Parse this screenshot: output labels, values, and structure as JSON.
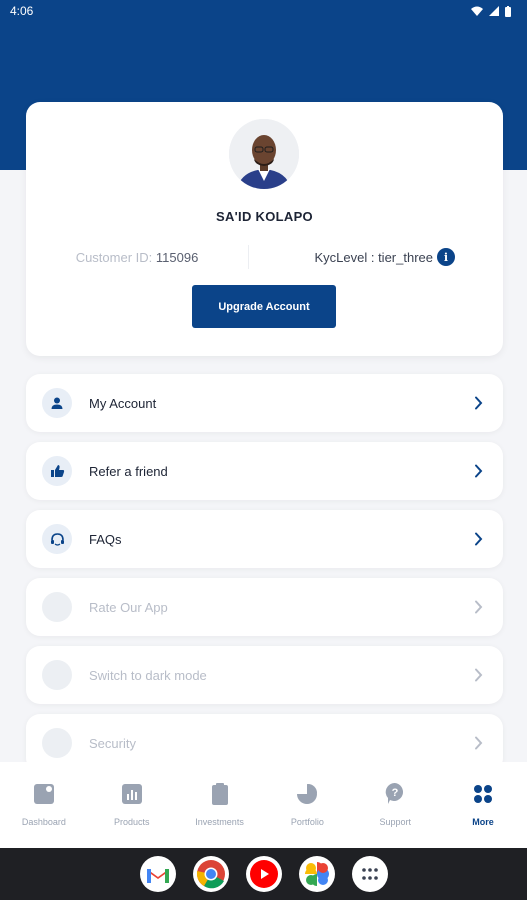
{
  "status_bar": {
    "time": "4:06"
  },
  "profile": {
    "name": "SA'ID KOLAPO",
    "customer_id_label": "Customer ID:",
    "customer_id_value": "115096",
    "kyc_label": "KycLevel : tier_three",
    "info_icon": "i",
    "upgrade_label": "Upgrade Account"
  },
  "menu": [
    {
      "label": "My Account",
      "icon": "person-icon",
      "enabled": true
    },
    {
      "label": "Refer a friend",
      "icon": "thumbs-up-icon",
      "enabled": true
    },
    {
      "label": "FAQs",
      "icon": "faq-icon",
      "enabled": true
    },
    {
      "label": "Rate Our App",
      "icon": "star-icon",
      "enabled": false
    },
    {
      "label": "Switch to dark mode",
      "icon": "moon-icon",
      "enabled": false
    },
    {
      "label": "Security",
      "icon": "shield-icon",
      "enabled": false
    }
  ],
  "bottom_nav": [
    {
      "label": "Dashboard",
      "icon": "dashboard-icon",
      "active": false
    },
    {
      "label": "Products",
      "icon": "products-icon",
      "active": false
    },
    {
      "label": "Investments",
      "icon": "investments-icon",
      "active": false
    },
    {
      "label": "Portfolio",
      "icon": "portfolio-icon",
      "active": false
    },
    {
      "label": "Support",
      "icon": "support-icon",
      "active": false
    },
    {
      "label": "More",
      "icon": "more-icon",
      "active": true
    }
  ],
  "dock_apps": [
    "gmail-icon",
    "chrome-icon",
    "youtube-icon",
    "photos-icon",
    "app-drawer-icon"
  ],
  "colors": {
    "brand": "#0b4489",
    "background": "#f4f5f8",
    "muted": "#b8bdc8"
  }
}
